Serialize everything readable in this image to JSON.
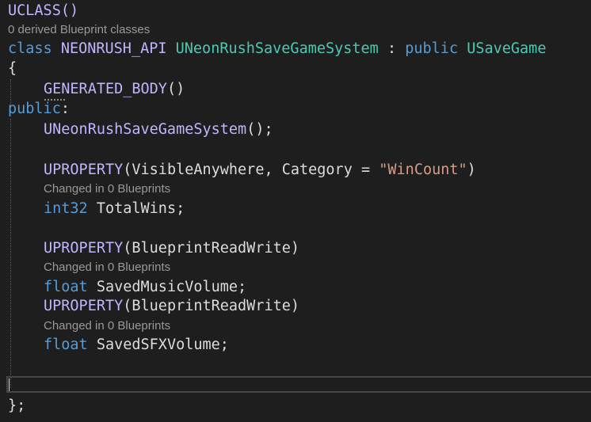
{
  "code": {
    "uclass": "UCLASS()",
    "uclass_paren": "",
    "hint_derived": "0 derived Blueprint classes",
    "class_kw": "class",
    "api_macro": "NEONRUSH_API",
    "class_name": "UNeonRushSaveGameSystem",
    "colon": " : ",
    "public_kw": "public",
    "base_class": "USaveGame",
    "open_brace": "{",
    "generated_body": "GENERATED_BODY",
    "parens": "()",
    "public_label": "public",
    "public_colon": ":",
    "ctor_name": "UNeonRushSaveGameSystem",
    "ctor_tail": "();",
    "uproperty": "UPROPERTY",
    "prop1_args_open": "(VisibleAnywhere, Category = ",
    "prop1_string": "\"WinCount\"",
    "prop1_args_close": ")",
    "hint_changed": "Changed in 0 Blueprints",
    "int32": "int32",
    "total_wins": " TotalWins;",
    "prop2_args": "(BlueprintReadWrite)",
    "float": "float",
    "music_volume": " SavedMusicVolume;",
    "sfx_volume": " SavedSFXVolume;",
    "close_brace": "};"
  },
  "colors": {
    "background": "#1e1e1e",
    "keyword": "#569cd6",
    "macro": "#beb7ff",
    "type": "#4ec9b0",
    "string": "#d69d85",
    "text": "#dcdcdc",
    "hint": "#999999"
  }
}
